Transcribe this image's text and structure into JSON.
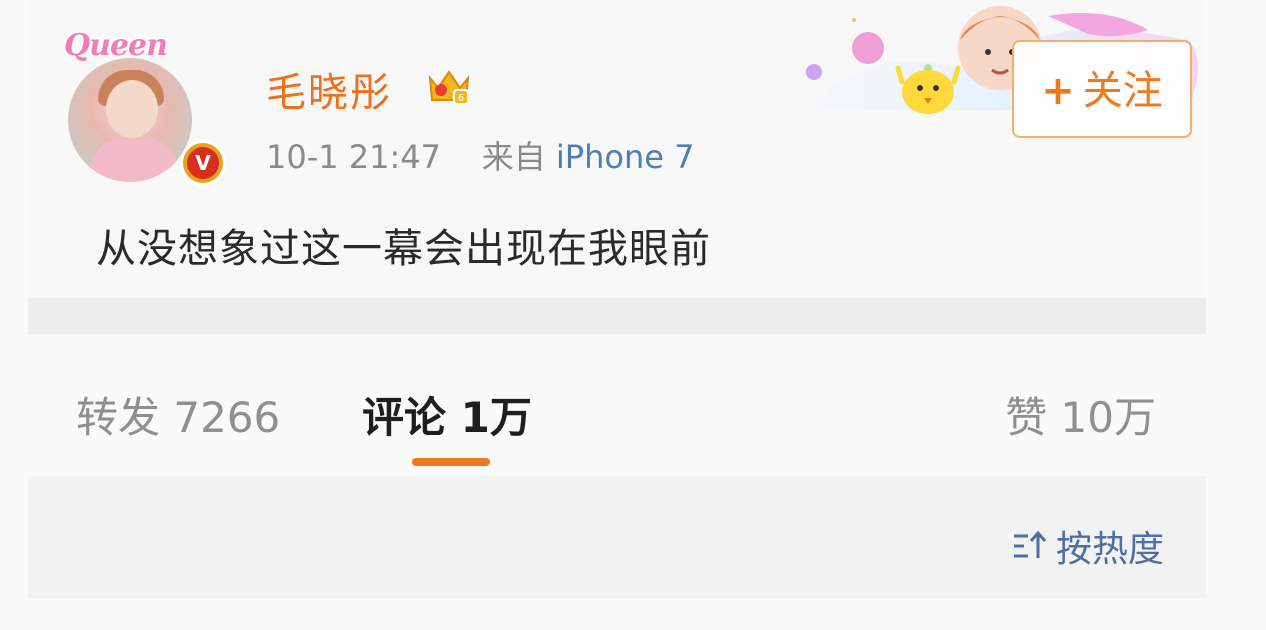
{
  "post": {
    "username": "毛晓彤",
    "avatar_frame_text": "Queen",
    "verified_mark": "V",
    "timestamp": "10-1 21:47",
    "source_prefix": "来自",
    "source_device": "iPhone 7",
    "text": "从没想象过这一幕会出现在我眼前",
    "follow_label": "关注",
    "follow_plus": "+",
    "vip_level": "6"
  },
  "tabs": {
    "repost": "转发 7266",
    "comments": "评论 1万",
    "likes": "赞 10万"
  },
  "comments": {
    "sort_label": "按热度"
  },
  "colors": {
    "username": "#f0701a",
    "accent": "#f07a1a",
    "link": "#4e7fb4",
    "muted": "#8a8a8a"
  },
  "icons": {
    "vip": "crown-icon",
    "verified": "verified-v-icon",
    "sort": "sort-icon"
  }
}
